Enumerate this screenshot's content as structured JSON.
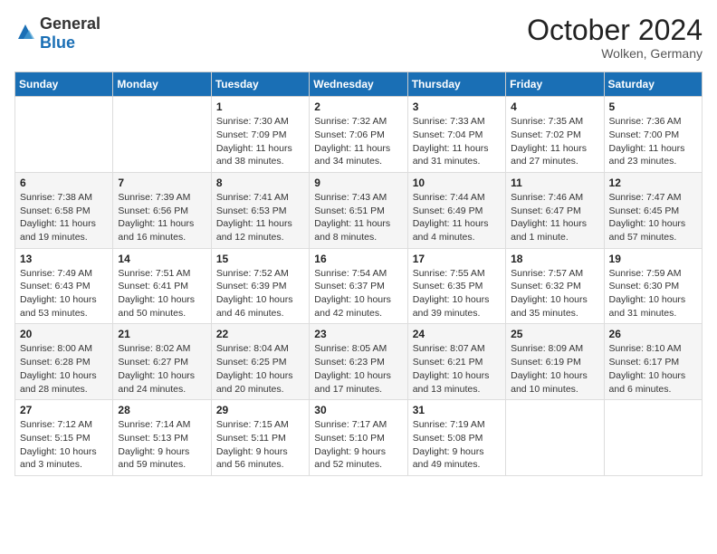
{
  "logo": {
    "general": "General",
    "blue": "Blue"
  },
  "header": {
    "month": "October 2024",
    "location": "Wolken, Germany"
  },
  "weekdays": [
    "Sunday",
    "Monday",
    "Tuesday",
    "Wednesday",
    "Thursday",
    "Friday",
    "Saturday"
  ],
  "weeks": [
    [
      {
        "day": "",
        "sunrise": "",
        "sunset": "",
        "daylight": ""
      },
      {
        "day": "",
        "sunrise": "",
        "sunset": "",
        "daylight": ""
      },
      {
        "day": "1",
        "sunrise": "Sunrise: 7:30 AM",
        "sunset": "Sunset: 7:09 PM",
        "daylight": "Daylight: 11 hours and 38 minutes."
      },
      {
        "day": "2",
        "sunrise": "Sunrise: 7:32 AM",
        "sunset": "Sunset: 7:06 PM",
        "daylight": "Daylight: 11 hours and 34 minutes."
      },
      {
        "day": "3",
        "sunrise": "Sunrise: 7:33 AM",
        "sunset": "Sunset: 7:04 PM",
        "daylight": "Daylight: 11 hours and 31 minutes."
      },
      {
        "day": "4",
        "sunrise": "Sunrise: 7:35 AM",
        "sunset": "Sunset: 7:02 PM",
        "daylight": "Daylight: 11 hours and 27 minutes."
      },
      {
        "day": "5",
        "sunrise": "Sunrise: 7:36 AM",
        "sunset": "Sunset: 7:00 PM",
        "daylight": "Daylight: 11 hours and 23 minutes."
      }
    ],
    [
      {
        "day": "6",
        "sunrise": "Sunrise: 7:38 AM",
        "sunset": "Sunset: 6:58 PM",
        "daylight": "Daylight: 11 hours and 19 minutes."
      },
      {
        "day": "7",
        "sunrise": "Sunrise: 7:39 AM",
        "sunset": "Sunset: 6:56 PM",
        "daylight": "Daylight: 11 hours and 16 minutes."
      },
      {
        "day": "8",
        "sunrise": "Sunrise: 7:41 AM",
        "sunset": "Sunset: 6:53 PM",
        "daylight": "Daylight: 11 hours and 12 minutes."
      },
      {
        "day": "9",
        "sunrise": "Sunrise: 7:43 AM",
        "sunset": "Sunset: 6:51 PM",
        "daylight": "Daylight: 11 hours and 8 minutes."
      },
      {
        "day": "10",
        "sunrise": "Sunrise: 7:44 AM",
        "sunset": "Sunset: 6:49 PM",
        "daylight": "Daylight: 11 hours and 4 minutes."
      },
      {
        "day": "11",
        "sunrise": "Sunrise: 7:46 AM",
        "sunset": "Sunset: 6:47 PM",
        "daylight": "Daylight: 11 hours and 1 minute."
      },
      {
        "day": "12",
        "sunrise": "Sunrise: 7:47 AM",
        "sunset": "Sunset: 6:45 PM",
        "daylight": "Daylight: 10 hours and 57 minutes."
      }
    ],
    [
      {
        "day": "13",
        "sunrise": "Sunrise: 7:49 AM",
        "sunset": "Sunset: 6:43 PM",
        "daylight": "Daylight: 10 hours and 53 minutes."
      },
      {
        "day": "14",
        "sunrise": "Sunrise: 7:51 AM",
        "sunset": "Sunset: 6:41 PM",
        "daylight": "Daylight: 10 hours and 50 minutes."
      },
      {
        "day": "15",
        "sunrise": "Sunrise: 7:52 AM",
        "sunset": "Sunset: 6:39 PM",
        "daylight": "Daylight: 10 hours and 46 minutes."
      },
      {
        "day": "16",
        "sunrise": "Sunrise: 7:54 AM",
        "sunset": "Sunset: 6:37 PM",
        "daylight": "Daylight: 10 hours and 42 minutes."
      },
      {
        "day": "17",
        "sunrise": "Sunrise: 7:55 AM",
        "sunset": "Sunset: 6:35 PM",
        "daylight": "Daylight: 10 hours and 39 minutes."
      },
      {
        "day": "18",
        "sunrise": "Sunrise: 7:57 AM",
        "sunset": "Sunset: 6:32 PM",
        "daylight": "Daylight: 10 hours and 35 minutes."
      },
      {
        "day": "19",
        "sunrise": "Sunrise: 7:59 AM",
        "sunset": "Sunset: 6:30 PM",
        "daylight": "Daylight: 10 hours and 31 minutes."
      }
    ],
    [
      {
        "day": "20",
        "sunrise": "Sunrise: 8:00 AM",
        "sunset": "Sunset: 6:28 PM",
        "daylight": "Daylight: 10 hours and 28 minutes."
      },
      {
        "day": "21",
        "sunrise": "Sunrise: 8:02 AM",
        "sunset": "Sunset: 6:27 PM",
        "daylight": "Daylight: 10 hours and 24 minutes."
      },
      {
        "day": "22",
        "sunrise": "Sunrise: 8:04 AM",
        "sunset": "Sunset: 6:25 PM",
        "daylight": "Daylight: 10 hours and 20 minutes."
      },
      {
        "day": "23",
        "sunrise": "Sunrise: 8:05 AM",
        "sunset": "Sunset: 6:23 PM",
        "daylight": "Daylight: 10 hours and 17 minutes."
      },
      {
        "day": "24",
        "sunrise": "Sunrise: 8:07 AM",
        "sunset": "Sunset: 6:21 PM",
        "daylight": "Daylight: 10 hours and 13 minutes."
      },
      {
        "day": "25",
        "sunrise": "Sunrise: 8:09 AM",
        "sunset": "Sunset: 6:19 PM",
        "daylight": "Daylight: 10 hours and 10 minutes."
      },
      {
        "day": "26",
        "sunrise": "Sunrise: 8:10 AM",
        "sunset": "Sunset: 6:17 PM",
        "daylight": "Daylight: 10 hours and 6 minutes."
      }
    ],
    [
      {
        "day": "27",
        "sunrise": "Sunrise: 7:12 AM",
        "sunset": "Sunset: 5:15 PM",
        "daylight": "Daylight: 10 hours and 3 minutes."
      },
      {
        "day": "28",
        "sunrise": "Sunrise: 7:14 AM",
        "sunset": "Sunset: 5:13 PM",
        "daylight": "Daylight: 9 hours and 59 minutes."
      },
      {
        "day": "29",
        "sunrise": "Sunrise: 7:15 AM",
        "sunset": "Sunset: 5:11 PM",
        "daylight": "Daylight: 9 hours and 56 minutes."
      },
      {
        "day": "30",
        "sunrise": "Sunrise: 7:17 AM",
        "sunset": "Sunset: 5:10 PM",
        "daylight": "Daylight: 9 hours and 52 minutes."
      },
      {
        "day": "31",
        "sunrise": "Sunrise: 7:19 AM",
        "sunset": "Sunset: 5:08 PM",
        "daylight": "Daylight: 9 hours and 49 minutes."
      },
      {
        "day": "",
        "sunrise": "",
        "sunset": "",
        "daylight": ""
      },
      {
        "day": "",
        "sunrise": "",
        "sunset": "",
        "daylight": ""
      }
    ]
  ]
}
